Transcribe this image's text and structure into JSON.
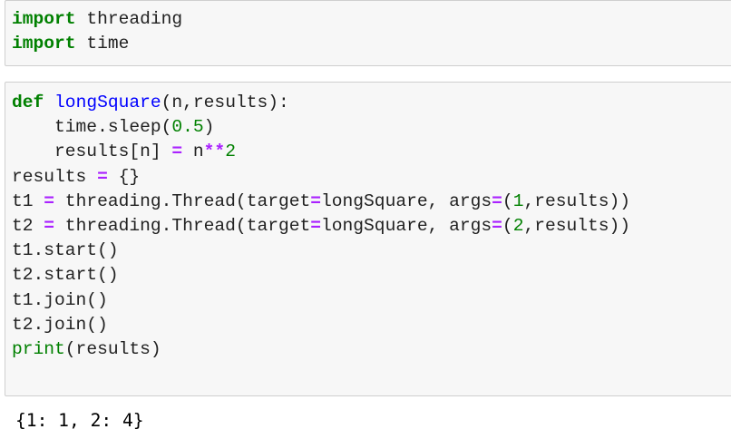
{
  "cells": [
    {
      "lines": [
        [
          {
            "t": "import",
            "c": "kw"
          },
          {
            "t": " threading",
            "c": ""
          }
        ],
        [
          {
            "t": "import",
            "c": "kw"
          },
          {
            "t": " time",
            "c": ""
          }
        ]
      ]
    },
    {
      "lines": [
        [
          {
            "t": "def",
            "c": "kw"
          },
          {
            "t": " ",
            "c": ""
          },
          {
            "t": "longSquare",
            "c": "fn"
          },
          {
            "t": "(n,results):",
            "c": ""
          }
        ],
        [
          {
            "t": "    time.sleep(",
            "c": ""
          },
          {
            "t": "0.5",
            "c": "num"
          },
          {
            "t": ")",
            "c": ""
          }
        ],
        [
          {
            "t": "    results[n] ",
            "c": ""
          },
          {
            "t": "=",
            "c": "op"
          },
          {
            "t": " n",
            "c": ""
          },
          {
            "t": "**",
            "c": "op"
          },
          {
            "t": "2",
            "c": "num"
          }
        ],
        [
          {
            "t": "results ",
            "c": ""
          },
          {
            "t": "=",
            "c": "op"
          },
          {
            "t": " {}",
            "c": ""
          }
        ],
        [
          {
            "t": "t1 ",
            "c": ""
          },
          {
            "t": "=",
            "c": "op"
          },
          {
            "t": " threading.Thread(target",
            "c": ""
          },
          {
            "t": "=",
            "c": "op"
          },
          {
            "t": "longSquare, args",
            "c": ""
          },
          {
            "t": "=",
            "c": "op"
          },
          {
            "t": "(",
            "c": ""
          },
          {
            "t": "1",
            "c": "num"
          },
          {
            "t": ",results))",
            "c": ""
          }
        ],
        [
          {
            "t": "t2 ",
            "c": ""
          },
          {
            "t": "=",
            "c": "op"
          },
          {
            "t": " threading.Thread(target",
            "c": ""
          },
          {
            "t": "=",
            "c": "op"
          },
          {
            "t": "longSquare, args",
            "c": ""
          },
          {
            "t": "=",
            "c": "op"
          },
          {
            "t": "(",
            "c": ""
          },
          {
            "t": "2",
            "c": "num"
          },
          {
            "t": ",results))",
            "c": ""
          }
        ],
        [
          {
            "t": "t1.start()",
            "c": ""
          }
        ],
        [
          {
            "t": "t2.start()",
            "c": ""
          }
        ],
        [
          {
            "t": "t1.join()",
            "c": ""
          }
        ],
        [
          {
            "t": "t2.join()",
            "c": ""
          }
        ],
        [
          {
            "t": "print",
            "c": "bi"
          },
          {
            "t": "(results)",
            "c": ""
          }
        ]
      ]
    }
  ],
  "output": "{1: 1, 2: 4}",
  "colors": {
    "keyword": "#008000",
    "function_name": "#0000ff",
    "operator": "#aa22ff",
    "number": "#008000",
    "builtin": "#008000",
    "cell_background": "#f7f7f7",
    "cell_border": "#cfcfcf"
  }
}
